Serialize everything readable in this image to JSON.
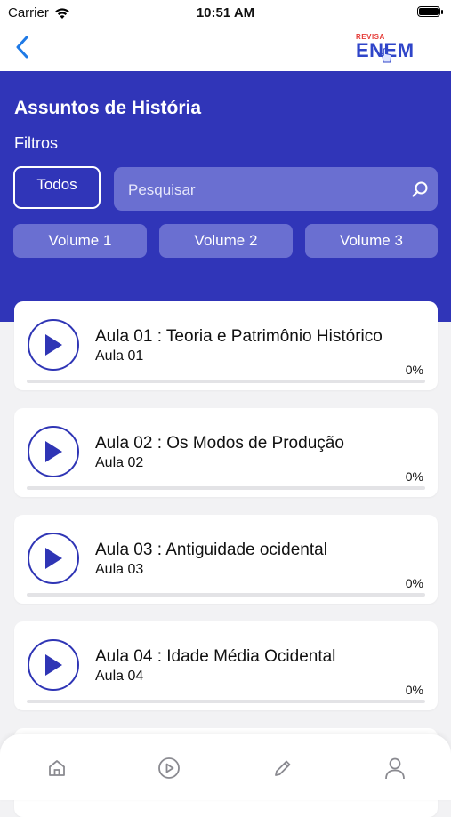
{
  "status_bar": {
    "carrier": "Carrier",
    "time": "10:51 AM"
  },
  "nav": {
    "back_icon": "chevron-left-icon"
  },
  "logo": {
    "top": "REVISA",
    "main": "ENEM"
  },
  "header": {
    "title": "Assuntos de História",
    "filters_label": "Filtros",
    "todos_label": "Todos",
    "search_placeholder": "Pesquisar",
    "volumes": [
      "Volume 1",
      "Volume 2",
      "Volume 3"
    ]
  },
  "lessons": [
    {
      "title": "Aula 01 : Teoria e Patrimônio Histórico",
      "subtitle": "Aula 01",
      "percent": "0%",
      "progress": 0
    },
    {
      "title": "Aula 02 : Os Modos de Produção",
      "subtitle": "Aula 02",
      "percent": "0%",
      "progress": 0
    },
    {
      "title": "Aula 03 : Antiguidade ocidental",
      "subtitle": "Aula 03",
      "percent": "0%",
      "progress": 0
    },
    {
      "title": "Aula 04 : Idade Média Ocidental",
      "subtitle": "Aula 04",
      "percent": "0%",
      "progress": 0
    }
  ],
  "tab_bar": {
    "icons": [
      "home-icon",
      "play-circle-icon",
      "pencil-icon",
      "user-icon"
    ]
  },
  "colors": {
    "primary": "#3035b8",
    "accent": "#2f35b5",
    "chip": "#6a6fd1",
    "logo_red": "#e53935",
    "logo_blue": "#2f45c9"
  }
}
